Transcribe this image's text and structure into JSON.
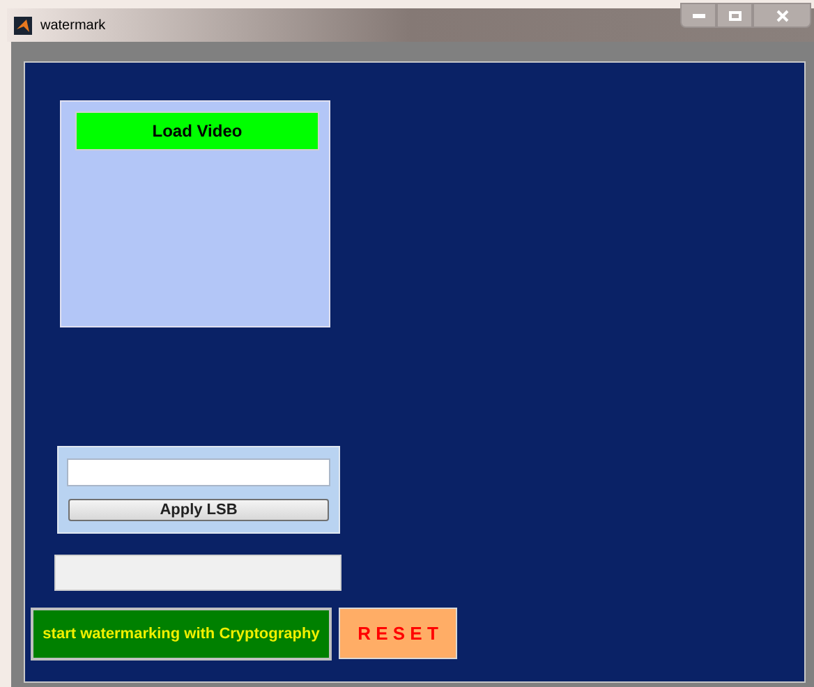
{
  "window": {
    "title": "watermark"
  },
  "video_panel": {
    "button": "Load Video"
  },
  "lsb_panel": {
    "button": "Apply LSB"
  },
  "buttons": [
    {
      "kind": "start",
      "label": "start watermarking with Cryptography"
    },
    {
      "kind": "reset",
      "label": "R E S E T"
    }
  ]
}
